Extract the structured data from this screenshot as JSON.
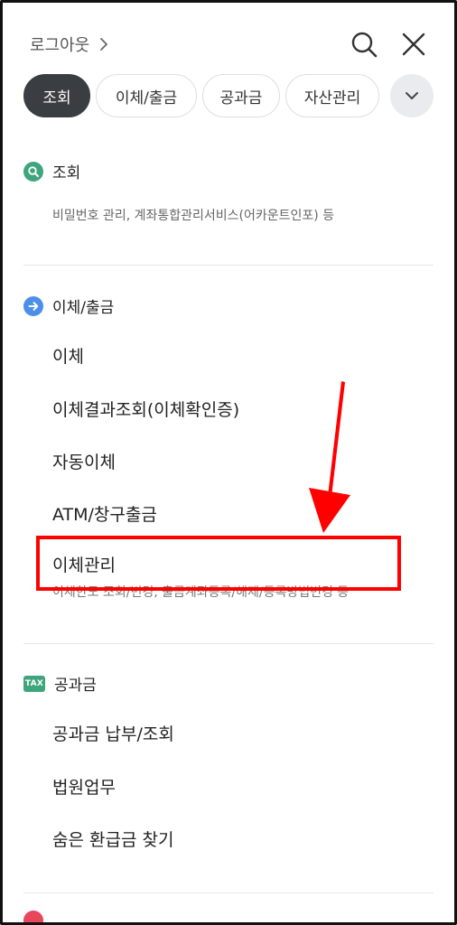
{
  "header": {
    "logout_label": "로그아웃",
    "icons": [
      "search-icon",
      "close-icon"
    ]
  },
  "tabs": [
    {
      "label": "조회",
      "active": true
    },
    {
      "label": "이체/출금",
      "active": false
    },
    {
      "label": "공과금",
      "active": false
    },
    {
      "label": "자산관리",
      "active": false
    }
  ],
  "sections": {
    "inquiry": {
      "title": "조회",
      "description": "비밀번호 관리, 계좌통합관리서비스(어카운트인포) 등"
    },
    "transfer": {
      "title": "이체/출금",
      "items": [
        {
          "label": "이체"
        },
        {
          "label": "이체결과조회(이체확인증)"
        },
        {
          "label": "자동이체"
        },
        {
          "label": "ATM/창구출금"
        },
        {
          "label": "이체관리",
          "description": "이체한도 조회/변경, 출금계좌등록/해제/등록방법변경 등"
        }
      ]
    },
    "utility": {
      "badge": "TAX",
      "title": "공과금",
      "items": [
        {
          "label": "공과금 납부/조회"
        },
        {
          "label": "법원업무"
        },
        {
          "label": "숨은 환급금 찾기"
        }
      ]
    }
  },
  "colors": {
    "active_tab": "#3a3d42",
    "inquiry_badge": "#3fa57c",
    "transfer_badge": "#4b8fe9",
    "tax_badge": "#3fa57c",
    "annotation": "#ff0000"
  }
}
